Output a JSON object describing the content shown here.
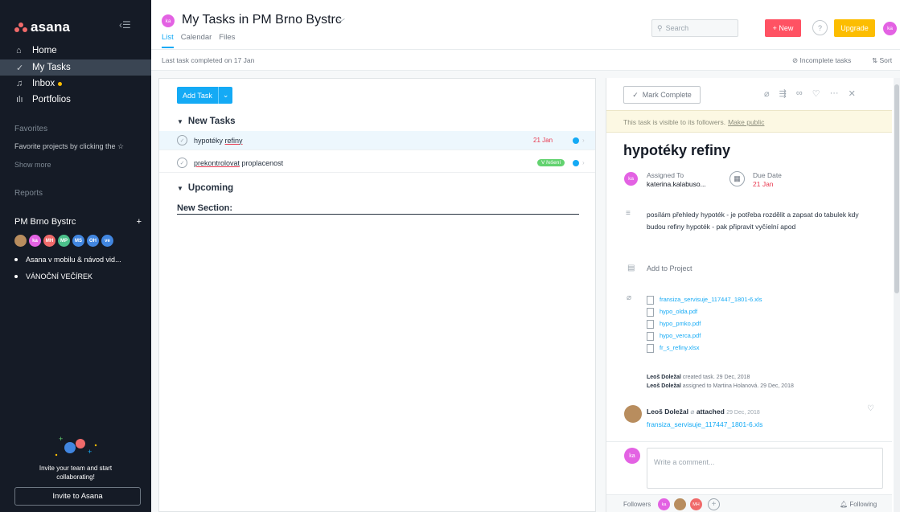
{
  "sidebar": {
    "logo": "asana",
    "nav": [
      {
        "label": "Home",
        "icon": "home-icon"
      },
      {
        "label": "My Tasks",
        "icon": "check-circle-icon"
      },
      {
        "label": "Inbox",
        "icon": "bell-icon"
      },
      {
        "label": "Portfolios",
        "icon": "bar-chart-icon"
      }
    ],
    "favorites_title": "Favorites",
    "favorites_hint": "Favorite projects by clicking the ☆",
    "show_more": "Show more",
    "reports_title": "Reports",
    "team": "PM Brno Bystrc",
    "team_add": "+",
    "members": [
      {
        "initials": "",
        "color": "#b88d5e"
      },
      {
        "initials": "ka",
        "color": "#e362e3"
      },
      {
        "initials": "MH",
        "color": "#f06a6a"
      },
      {
        "initials": "MP",
        "color": "#4bc08a"
      },
      {
        "initials": "MS",
        "color": "#4186e0"
      },
      {
        "initials": "OH",
        "color": "#4186e0"
      },
      {
        "initials": "ve",
        "color": "#4186e0"
      }
    ],
    "projects": [
      "Asana v mobilu & návod vid...",
      "VÁNOČNÍ VEČÍREK"
    ],
    "invite_text": "Invite your team and start collaborating!",
    "invite_button": "Invite to Asana"
  },
  "topbar": {
    "avatar": "ka",
    "title": "My Tasks in PM Brno Bystrc",
    "tabs": [
      "List",
      "Calendar",
      "Files"
    ],
    "search_placeholder": "Search",
    "new_label": "+ New",
    "help_label": "?",
    "upgrade_label": "Upgrade",
    "user_initials": "ka"
  },
  "subbar": {
    "last_completed": "Last task completed on 17 Jan",
    "filter": "⊘ Incomplete tasks",
    "sort": "⇅ Sort"
  },
  "list": {
    "add_task": "Add Task",
    "sections": [
      {
        "title": "New Tasks"
      },
      {
        "title": "Upcoming"
      }
    ],
    "tasks": [
      {
        "pre": "hypotéky ",
        "underlined": "refiny",
        "post": "",
        "due": "21 Jan"
      },
      {
        "pre": "",
        "underlined": "prekontrolovat",
        "post": " proplacenost",
        "tag": "V řešení"
      }
    ],
    "new_section": "New Section:"
  },
  "detail": {
    "mark_complete": "Mark Complete",
    "visibility_text": "This task is visible to its followers.",
    "make_public": "Make public",
    "title": "hypotéky refiny",
    "assigned_to_label": "Assigned To",
    "assignee": "katerina.kalabuso...",
    "assignee_initials": "ka",
    "due_label": "Due Date",
    "due_value": "21 Jan",
    "description": "posílám přehledy hypoték - je potřeba rozdělit a zapsat do tabulek kdy budou refiny hypoték - pak připravit vyčíelní apod",
    "add_to_project": "Add to Project",
    "attachments": [
      "fransiza_servisuje_117447_1801-6.xls",
      "hypo_olda.pdf",
      "hypo_pmko.pdf",
      "hypo_verca.pdf",
      "fr_s_refiny.xlsx"
    ],
    "history": [
      {
        "author": "Leoš Doležal",
        "text": " created task.  29 Dec, 2018"
      },
      {
        "author": "Leoš Doležal",
        "text": " assigned to Martina Holanová.  29 Dec, 2018"
      }
    ],
    "comment": {
      "author": "Leoš Doležal",
      "action": "attached",
      "date": "29 Dec, 2018",
      "file": "fransiza_servisuje_117447_1801-6.xls"
    },
    "comment_avatar": "ka",
    "comment_placeholder": "Write a comment...",
    "followers_label": "Followers",
    "followers": [
      {
        "initials": "ka",
        "color": "#e362e3"
      },
      {
        "initials": "",
        "color": "#b88d5e"
      },
      {
        "initials": "MH",
        "color": "#f06a6a"
      }
    ],
    "following_label": "Following"
  }
}
